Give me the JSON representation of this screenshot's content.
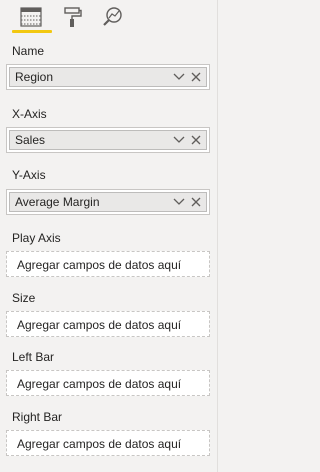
{
  "tabs": [
    {
      "icon": "fields-grid-icon",
      "active": true
    },
    {
      "icon": "paint-roller-icon",
      "active": false
    },
    {
      "icon": "analytics-magnifier-icon",
      "active": false
    }
  ],
  "wells": {
    "name": {
      "label": "Name",
      "value": "Region"
    },
    "x_axis": {
      "label": "X-Axis",
      "value": "Sales"
    },
    "y_axis": {
      "label": "Y-Axis",
      "value": "Average Margin"
    },
    "play_axis": {
      "label": "Play Axis",
      "placeholder": "Agregar campos de datos aquí"
    },
    "size": {
      "label": "Size",
      "placeholder": "Agregar campos de datos aquí"
    },
    "left_bar": {
      "label": "Left Bar",
      "placeholder": "Agregar campos de datos aquí"
    },
    "right_bar": {
      "label": "Right Bar",
      "placeholder": "Agregar campos de datos aquí"
    }
  },
  "colors": {
    "accent": "#f2c811",
    "panel_bg": "#f3f2f1",
    "pill_bg": "#e9e8e7"
  }
}
